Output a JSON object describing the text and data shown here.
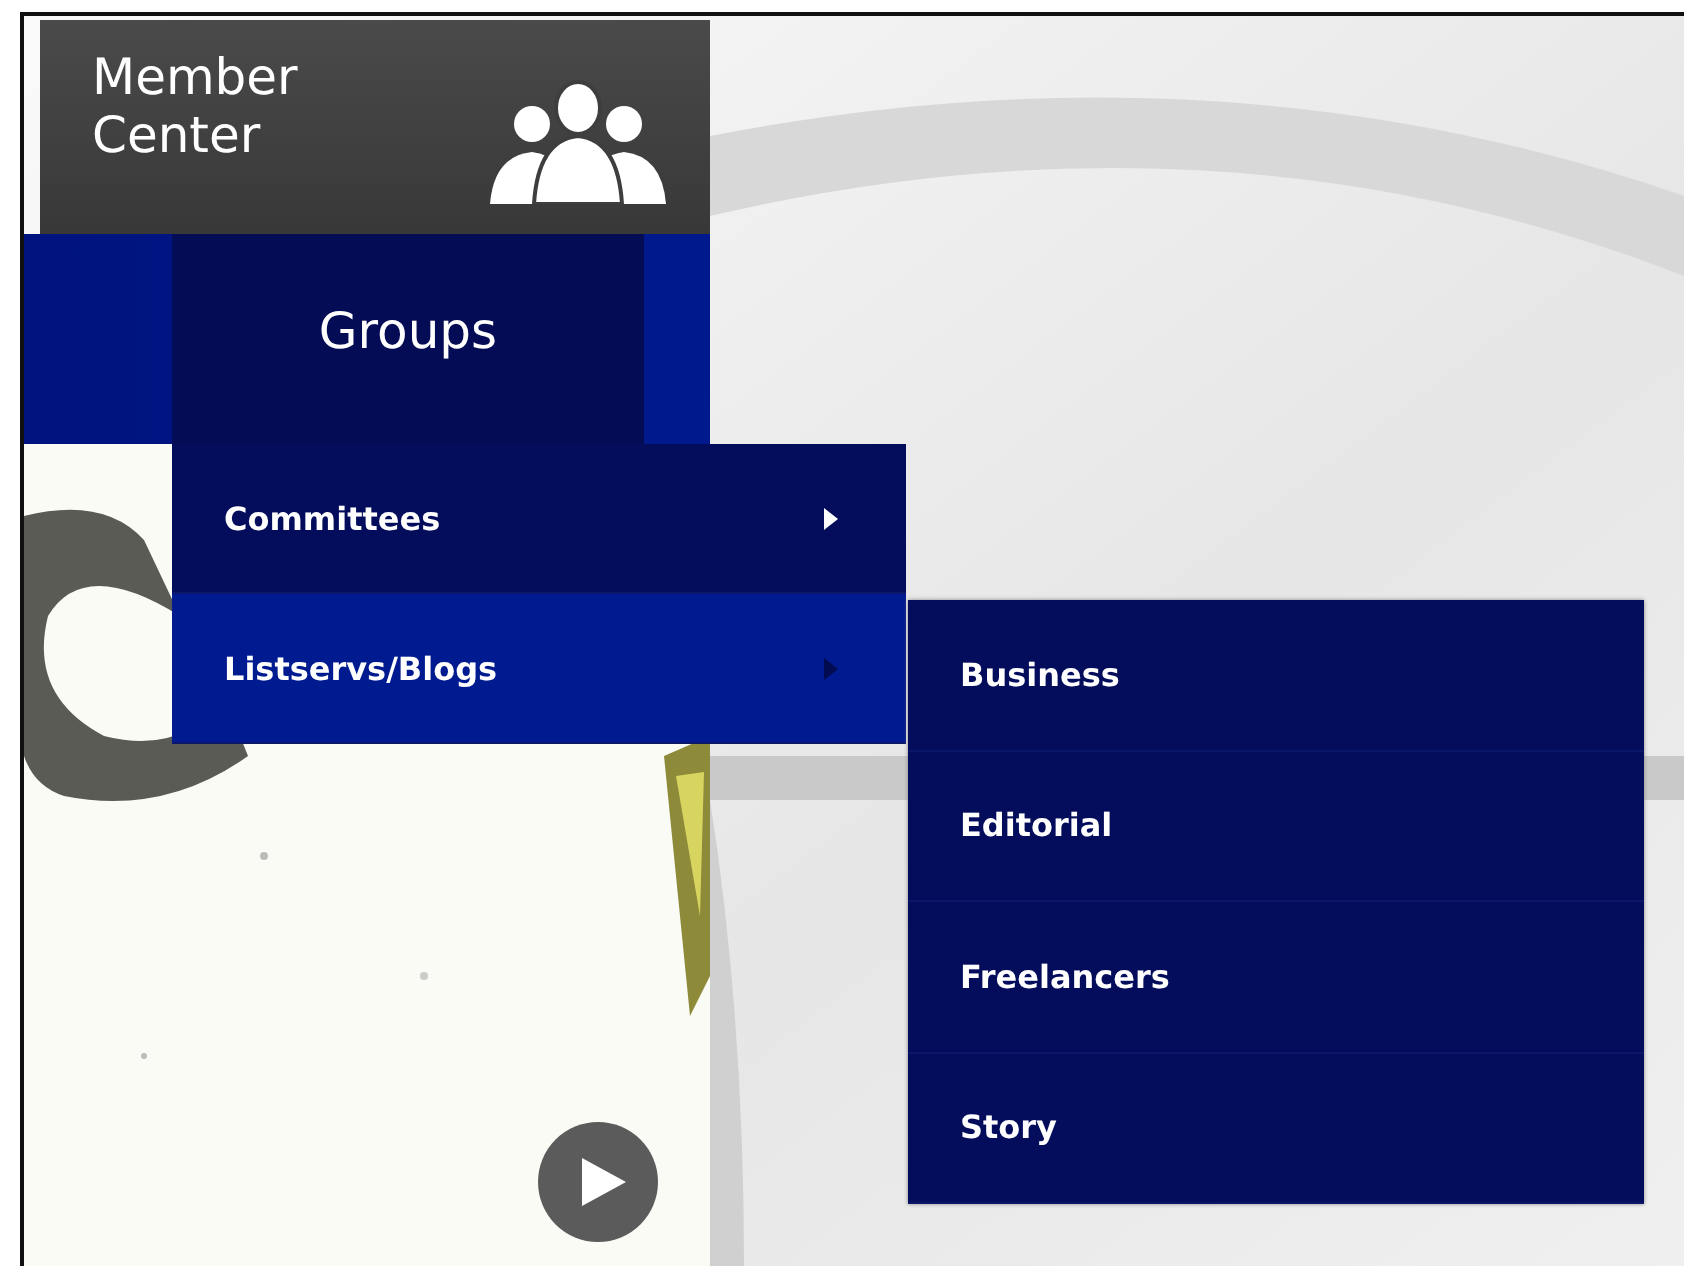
{
  "member_center": {
    "label": "Member Center"
  },
  "nav": {
    "tabs": [
      {
        "label": "Groups",
        "selected": true
      }
    ]
  },
  "menu": {
    "items": [
      {
        "label": "Committees",
        "selected": false,
        "has_submenu": true
      },
      {
        "label": "Listservs/Blogs",
        "selected": true,
        "has_submenu": true
      }
    ]
  },
  "submenu": {
    "items": [
      {
        "label": "Business"
      },
      {
        "label": "Editorial"
      },
      {
        "label": "Freelancers"
      },
      {
        "label": "Story"
      }
    ]
  }
}
